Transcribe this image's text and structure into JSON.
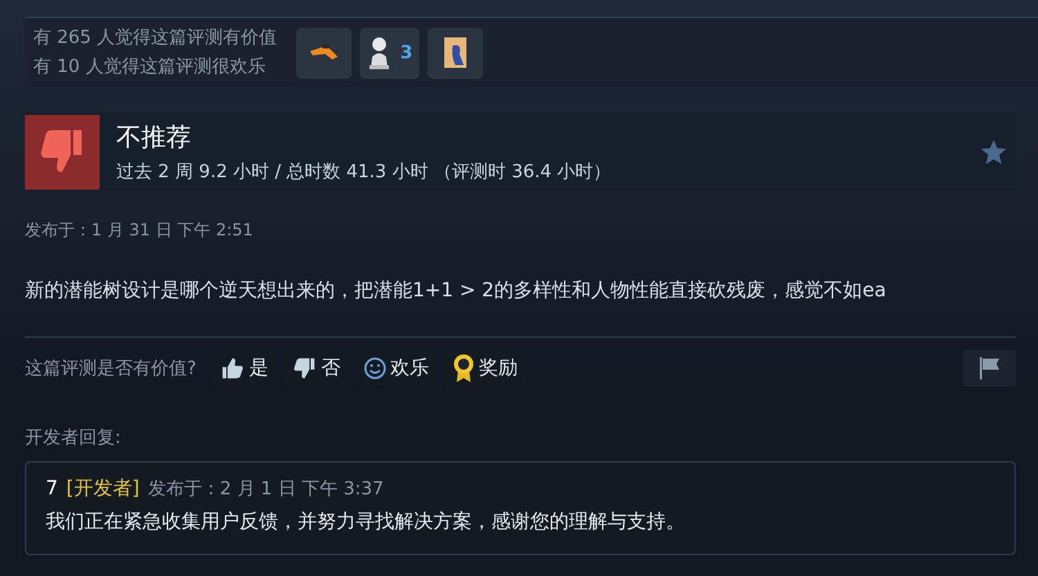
{
  "votes": {
    "helpful": "有 265 人觉得这篇评测有价值",
    "funny": "有 10 人觉得这篇评测很欢乐"
  },
  "awards": [
    {
      "kind": "hand"
    },
    {
      "kind": "bust",
      "count": "3"
    },
    {
      "kind": "scroll"
    }
  ],
  "review": {
    "recommended": false,
    "verdict": "不推荐",
    "hours": "过去 2 周 9.2 小时 / 总时数 41.3 小时 （评测时 36.4 小时）",
    "posted": "发布于：1 月 31 日 下午 2:51",
    "text": "新的潜能树设计是哪个逆天想出来的，把潜能1+1 > 2的多样性和人物性能直接砍残废，感觉不如ea"
  },
  "feedback": {
    "question": "这篇评测是否有价值?",
    "buttons": [
      {
        "kind": "yes",
        "label": "是"
      },
      {
        "kind": "no",
        "label": "否"
      },
      {
        "kind": "funny",
        "label": "欢乐"
      },
      {
        "kind": "award",
        "label": "奖励"
      }
    ]
  },
  "developer": {
    "heading": "开发者回复:",
    "name": "7",
    "badge": "[开发者]",
    "posted": "发布于：2 月 1 日 下午 3:37",
    "text": "我们正在紧急收集用户反馈，并努力寻找解决方案，感谢您的理解与支持。"
  }
}
